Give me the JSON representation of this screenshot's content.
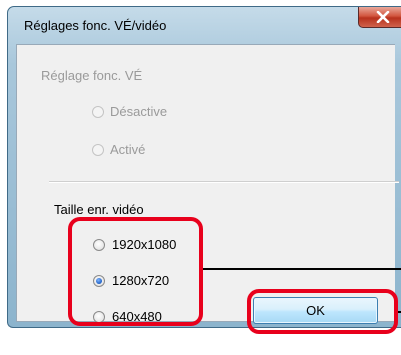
{
  "window": {
    "title": "Réglages fonc. VÉ/vidéo",
    "close_label": "X"
  },
  "ve_group": {
    "label": "Réglage fonc. VÉ",
    "options": [
      "Désactive",
      "Activé"
    ]
  },
  "video_group": {
    "label": "Taille enr. vidéo",
    "options": [
      "1920x1080",
      "1280x720",
      "640x480"
    ],
    "selected": "1280x720"
  },
  "ok_label": "OK",
  "colors": {
    "highlight": "#e8001c",
    "ok_border": "#3c7fb1",
    "close": "#c8412b"
  }
}
